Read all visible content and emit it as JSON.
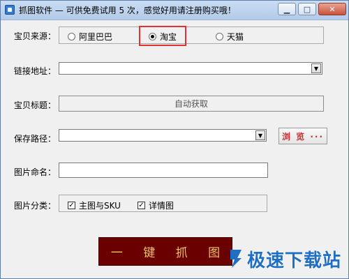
{
  "window": {
    "title": "抓图软件 — 可供免费试用 5 次，感觉好用请注册购买哦！",
    "min_icon": "▁",
    "max_icon": "□",
    "close_icon": "✕"
  },
  "source": {
    "label": "宝贝来源：",
    "options": [
      {
        "label": "阿里巴巴",
        "selected": false
      },
      {
        "label": "淘宝",
        "selected": true
      },
      {
        "label": "天猫",
        "selected": false
      }
    ]
  },
  "link": {
    "label": "链接地址：",
    "value": ""
  },
  "title_field": {
    "label": "宝贝标题：",
    "value": "自动获取"
  },
  "save_path": {
    "label": "保存路径：",
    "value": "",
    "browse_label": "浏 览 ···"
  },
  "image_name": {
    "label": "图片命名：",
    "value": ""
  },
  "image_category": {
    "label": "图片分类：",
    "options": [
      {
        "label": "主图与SKU",
        "checked": true
      },
      {
        "label": "详情图",
        "checked": true
      }
    ]
  },
  "action": {
    "grab_label": "一 键 抓 图"
  },
  "watermark": {
    "text": "极速下载站"
  },
  "colors": {
    "accent_red": "#c0302f",
    "button_bg": "#6b0000",
    "button_text": "#e8c46a",
    "watermark": "#1f6fc4"
  }
}
